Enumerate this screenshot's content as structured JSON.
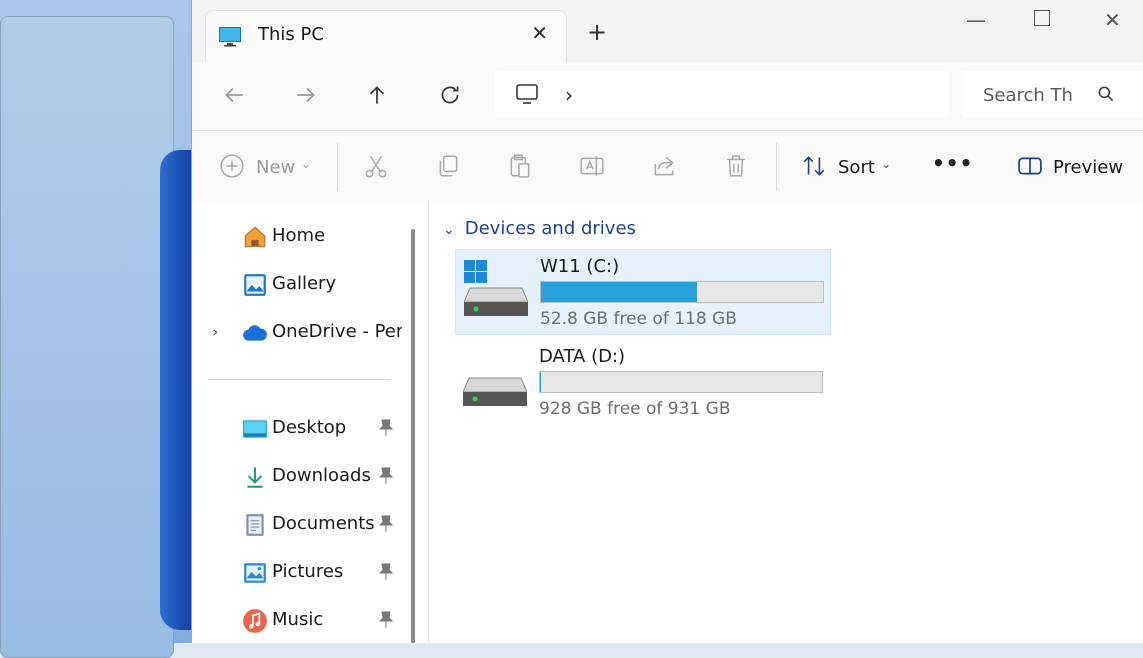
{
  "window": {
    "tab_title": "This PC",
    "icons": {
      "tab": "monitor-icon",
      "close": "close-icon",
      "new_tab": "plus-icon",
      "minimize": "minimize-icon",
      "maximize": "maximize-icon",
      "window_close": "close-icon"
    }
  },
  "address": {
    "location_icon": "monitor-icon",
    "breadcrumb_separator": "›"
  },
  "search": {
    "placeholder": "Search Th"
  },
  "commands": {
    "new_label": "New",
    "sort_label": "Sort",
    "preview_label": "Preview",
    "more_label": "•••"
  },
  "navigation": {
    "items": [
      {
        "label": "Home",
        "icon": "home-icon"
      },
      {
        "label": "Gallery",
        "icon": "gallery-icon"
      },
      {
        "label": "OneDrive - Perso",
        "icon": "cloud-icon"
      }
    ],
    "quick_access": [
      {
        "label": "Desktop",
        "icon": "desktop-icon",
        "pinned": true
      },
      {
        "label": "Downloads",
        "icon": "download-icon",
        "pinned": true
      },
      {
        "label": "Documents",
        "icon": "document-icon",
        "pinned": true
      },
      {
        "label": "Pictures",
        "icon": "pictures-icon",
        "pinned": true
      },
      {
        "label": "Music",
        "icon": "music-icon",
        "pinned": true
      }
    ]
  },
  "content": {
    "group_title": "Devices and drives",
    "drives": [
      {
        "name": "W11 (C:)",
        "free_text": "52.8 GB free of 118 GB",
        "used_fraction": 0.553,
        "selected": true,
        "system": true
      },
      {
        "name": "DATA (D:)",
        "free_text": "928 GB free of 931 GB",
        "used_fraction": 0.003,
        "selected": false,
        "system": false
      }
    ]
  },
  "colors": {
    "accent": "#26a0da",
    "selection": "#e5f1fb",
    "group_header": "#1f3f8f"
  }
}
